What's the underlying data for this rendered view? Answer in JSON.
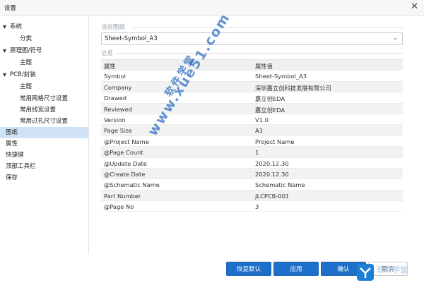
{
  "window": {
    "title": "设置"
  },
  "sidebar": {
    "items": [
      {
        "label": "系统",
        "caret": "▼"
      },
      {
        "label": "分类"
      },
      {
        "label": "原理图/符号",
        "caret": "▼"
      },
      {
        "label": "主题"
      },
      {
        "label": "PCB/封装",
        "caret": "▼"
      },
      {
        "label": "主题"
      },
      {
        "label": "常用网格尺寸设置"
      },
      {
        "label": "常用线宽设置"
      },
      {
        "label": "常用过孔尺寸设置"
      },
      {
        "label": "图纸"
      },
      {
        "label": "属性"
      },
      {
        "label": "快捷键"
      },
      {
        "label": "顶部工具栏"
      },
      {
        "label": "保存"
      }
    ]
  },
  "main": {
    "current_sheet_label": "当前图纸",
    "sheet_select": {
      "value": "Sheet-Symbol_A3"
    },
    "info_label": "信息",
    "table": {
      "headers": [
        "属性",
        "属性值"
      ],
      "rows": [
        [
          "Symbol",
          "Sheet-Symbol_A3"
        ],
        [
          "Company",
          "深圳嘉立创科技发展有限公司"
        ],
        [
          "Drawed",
          "嘉立创EDA"
        ],
        [
          "Reviewed",
          "嘉立创EDA"
        ],
        [
          "Version",
          "V1.0"
        ],
        [
          "Page Size",
          "A3"
        ],
        [
          "@Project Name",
          "Project Name"
        ],
        [
          "@Page Count",
          "1"
        ],
        [
          "@Update Date",
          "2020.12.30"
        ],
        [
          "@Create Date",
          "2020.12.30"
        ],
        [
          "@Schematic Name",
          "Schematic Name"
        ],
        [
          "Part Number",
          "JLCPCB-001"
        ],
        [
          "@Page No",
          "3"
        ]
      ]
    }
  },
  "footer": {
    "restore_label": "恢复默认",
    "apply_label": "应用",
    "confirm_label": "确认",
    "cancel_label": "取消"
  },
  "watermark": {
    "url": "www.xue51.com",
    "name": "软件学堂"
  },
  "corner_logo": {
    "text": "软件学堂"
  },
  "colors": {
    "accent": "#1e6fc9",
    "selected_nav": "#cfe3f5"
  }
}
